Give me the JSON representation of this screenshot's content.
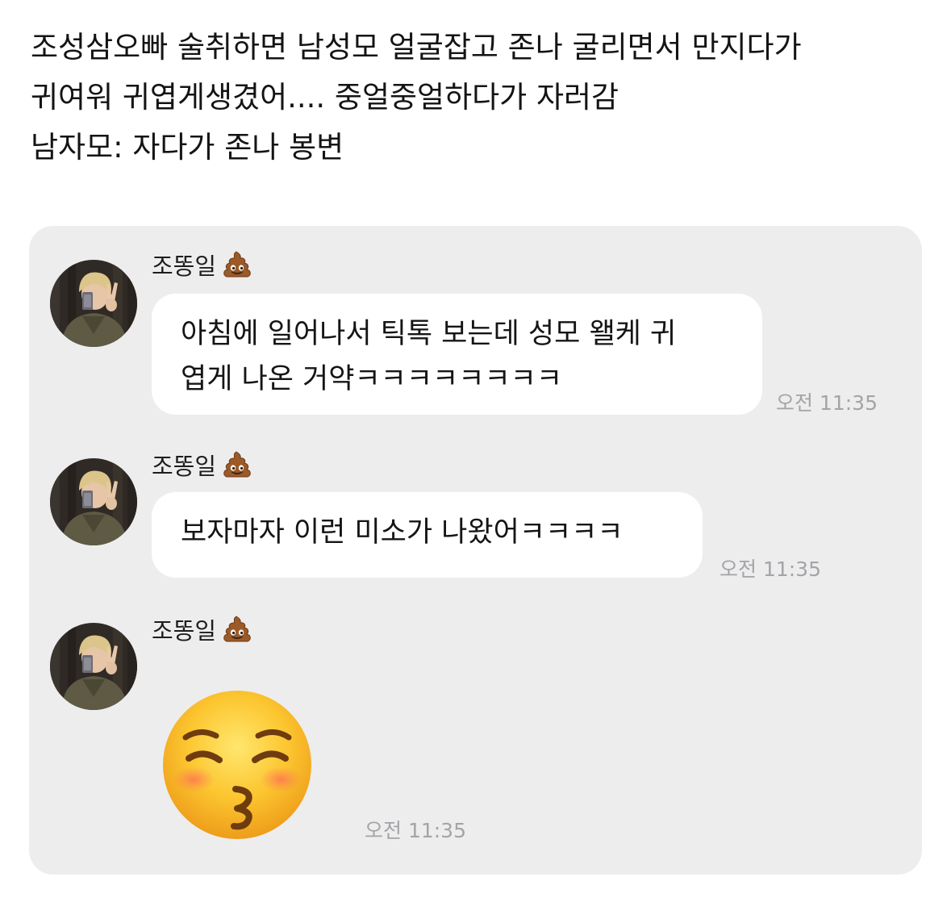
{
  "post": {
    "lines": [
      "조성삼오빠 술취하면 남성모 얼굴잡고 존나 굴리면서 만지다가",
      "귀여워 귀엽게생겼어.... 중얼중얼하다가 자러감",
      "남자모: 자다가 존나 봉변"
    ]
  },
  "chat": {
    "messages": [
      {
        "sender": "조똥일",
        "sender_emoji": "poop-emoji",
        "lines": [
          "아침에 일어나서 틱톡 보는데 성모 왤케 귀",
          "엽게 나온 거약ㅋㅋㅋㅋㅋㅋㅋㅋ"
        ],
        "time": "오전 11:35"
      },
      {
        "sender": "조똥일",
        "sender_emoji": "poop-emoji",
        "lines": [
          "보자마자 이런 미소가 나왔어ㅋㅋㅋㅋ"
        ],
        "time": "오전 11:35"
      },
      {
        "sender": "조똥일",
        "sender_emoji": "poop-emoji",
        "sticker": "kissing-closed-eyes-emoji",
        "time": "오전 11:35"
      }
    ]
  }
}
